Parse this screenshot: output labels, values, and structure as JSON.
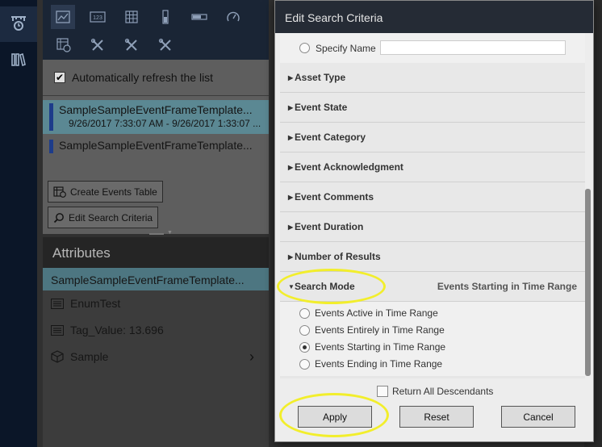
{
  "left_panel": {
    "auto_refresh_label": "Automatically refresh the list",
    "events": [
      {
        "name": "SampleSampleEventFrameTemplate...",
        "time": "9/26/2017 7:33:07 AM - 9/26/2017 1:33:07 ..."
      },
      {
        "name": "SampleSampleEventFrameTemplate..."
      }
    ],
    "create_table_label": "Create Events Table",
    "edit_criteria_label": "Edit Search Criteria"
  },
  "attributes": {
    "header": "Attributes",
    "selected": "SampleSampleEventFrameTemplate...",
    "rows": [
      {
        "label": "EnumTest"
      },
      {
        "label": "Tag_Value: 13.696"
      },
      {
        "label": "Sample"
      }
    ]
  },
  "dialog": {
    "title": "Edit Search Criteria",
    "specify_name_label": "Specify Name",
    "specify_name_value": "",
    "sections": [
      "Asset Type",
      "Event State",
      "Event Category",
      "Event Acknowledgment",
      "Event Comments",
      "Event Duration",
      "Number of Results"
    ],
    "search_mode": {
      "label": "Search Mode",
      "current": "Events Starting in Time Range",
      "options": [
        "Events Active in Time Range",
        "Events Entirely in Time Range",
        "Events Starting in Time Range",
        "Events Ending in Time Range"
      ],
      "selected_index": 2
    },
    "return_descendants_label": "Return All Descendants",
    "apply_label": "Apply",
    "reset_label": "Reset",
    "cancel_label": "Cancel"
  },
  "colors": {
    "highlight": "#f2ee2c",
    "dialog_title_bg": "#252b35",
    "selected_event_bg": "#5b8893"
  }
}
